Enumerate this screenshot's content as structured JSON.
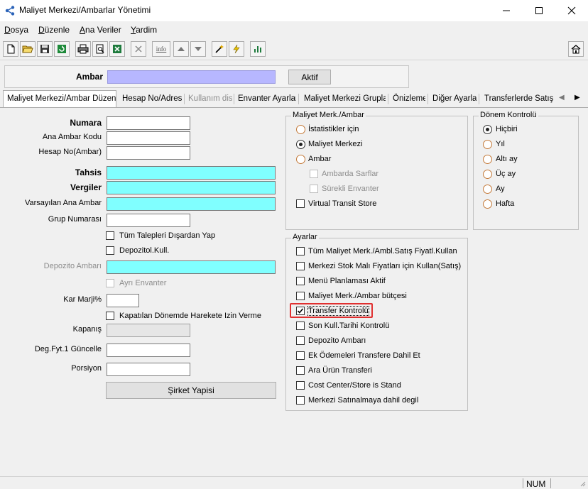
{
  "window": {
    "title": "Maliyet Merkezi/Ambarlar Yönetimi",
    "minimize_glyph": "—",
    "maximize_glyph": "☐",
    "close_glyph": "✕"
  },
  "menu": [
    {
      "mnemonic": "D",
      "rest": "osya"
    },
    {
      "mnemonic": "D",
      "rest": "üzenle"
    },
    {
      "mnemonic": "A",
      "rest": "na Veriler"
    },
    {
      "mnemonic": "Y",
      "rest": "ardim"
    }
  ],
  "toolbar": {
    "icons": [
      "new-icon",
      "open-icon",
      "save-icon",
      "refresh-icon",
      "print-icon",
      "print-preview-icon",
      "excel-icon",
      "delete-icon",
      "info-icon",
      "up-arrow-icon",
      "down-arrow-icon",
      "wand-icon",
      "lightning-icon",
      "chart-icon",
      "home-icon"
    ],
    "info_label": "info"
  },
  "header": {
    "ambar_label": "Ambar",
    "ambar_value": "",
    "aktif_button": "Aktif"
  },
  "tabs": [
    {
      "label": "Maliyet Merkezi/Ambar Düzenle",
      "active": true,
      "disabled": false
    },
    {
      "label": "Hesap No/Adres",
      "active": false,
      "disabled": false
    },
    {
      "label": "Kullanım disi",
      "active": false,
      "disabled": true
    },
    {
      "label": "Envanter Ayarları",
      "active": false,
      "disabled": false
    },
    {
      "label": "Maliyet Merkezi Grupları",
      "active": false,
      "disabled": false
    },
    {
      "label": "Önizleme",
      "active": false,
      "disabled": false
    },
    {
      "label": "Diğer Ayarlar",
      "active": false,
      "disabled": false
    },
    {
      "label": "Transferlerde Satış Fi",
      "active": false,
      "disabled": false
    }
  ],
  "tab_scroll": {
    "left": "◀",
    "right": "▶"
  },
  "form": {
    "numara_label": "Numara",
    "ana_ambar_kodu_label": "Ana Ambar Kodu",
    "hesap_no_label": "Hesap No(Ambar)",
    "tahsis_label": "Tahsis",
    "vergiler_label": "Vergiler",
    "varsayilan_label": "Varsayılan Ana Ambar",
    "grup_numarasi_label": "Grup Numarası",
    "tum_talepleri_label": "Tüm Talepleri Dışardan Yap",
    "depozitol_label": "Depozitol.Kull.",
    "depozito_ambari_label": "Depozito Ambarı",
    "ayri_envanter_label": "Ayrı Envanter",
    "kar_marji_label": "Kar Marji%",
    "kapatilan_label": "Kapatılan Dönemde Harekete Izin Verme",
    "kapanis_label": "Kapanış",
    "deg_fyt_label": "Deg.Fyt.1 Güncelle",
    "porsiyon_label": "Porsiyon",
    "sirket_button": "Şirket Yapisi"
  },
  "maliyet_group": {
    "title": "Maliyet Merk./Ambar",
    "options": [
      {
        "label": "İstatistikler için",
        "selected": false,
        "disabled": false
      },
      {
        "label": "Maliyet Merkezi",
        "selected": true,
        "disabled": false
      },
      {
        "label": "Ambar",
        "selected": false,
        "disabled": false
      }
    ],
    "ambarda_sarflar": "Ambarda Sarflar",
    "surekli_envanter": "Sürekli Envanter",
    "virtual_transit": "Virtual Transit Store"
  },
  "donem_group": {
    "title": "Dönem Kontrolü",
    "options": [
      {
        "label": "Hiçbiri",
        "selected": true
      },
      {
        "label": "Yıl",
        "selected": false
      },
      {
        "label": "Altı ay",
        "selected": false
      },
      {
        "label": "Üç ay",
        "selected": false
      },
      {
        "label": "Ay",
        "selected": false
      },
      {
        "label": "Hafta",
        "selected": false
      }
    ]
  },
  "ayarlar_group": {
    "title": "Ayarlar",
    "items": [
      {
        "label": "Tüm Maliyet Merk./Ambl.Satış Fiyatl.Kullan",
        "checked": false
      },
      {
        "label": "Merkezi Stok Malı Fiyatları için Kullan(Satış)",
        "checked": false
      },
      {
        "label": "Menü Planlaması Aktif",
        "checked": false
      },
      {
        "label": "Maliyet Merk./Ambar bütçesi",
        "checked": false
      },
      {
        "label": "Transfer Kontrolü",
        "checked": true
      },
      {
        "label": "Son Kull.Tarihi Kontrolü",
        "checked": false
      },
      {
        "label": "Depozito Ambarı",
        "checked": false
      },
      {
        "label": "Ek Ödemeleri Transfere Dahil Et",
        "checked": false
      },
      {
        "label": "Ara Ürün Transferi",
        "checked": false
      },
      {
        "label": "Cost Center/Store is Stand",
        "checked": false
      },
      {
        "label": "Merkezi Satınalmaya dahil degil",
        "checked": false
      }
    ]
  },
  "colors": {
    "cyan_field": "#80ffff",
    "lavender_field": "#b7b7ff",
    "highlight_red": "#e03030",
    "radio_orange": "#c47a3a"
  },
  "statusbar": {
    "num": "NUM"
  }
}
